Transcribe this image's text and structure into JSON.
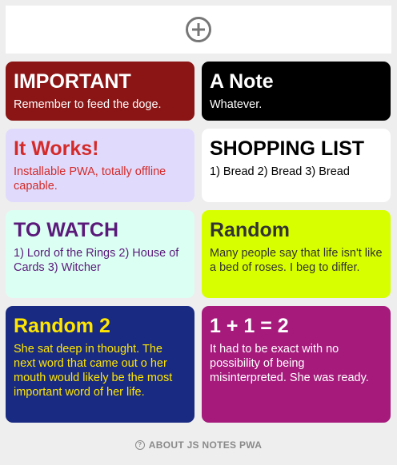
{
  "add_button": {
    "icon": "plus-circle-icon",
    "color": "#777777"
  },
  "notes": [
    {
      "title": "IMPORTANT",
      "body": "Remember to feed the doge.",
      "bg": "#8b1414",
      "fg": "#ffffff"
    },
    {
      "title": "A Note",
      "body": "Whatever.",
      "bg": "#000000",
      "fg": "#ffffff"
    },
    {
      "title": "It Works!",
      "body": "Installable PWA, totally offline capable.",
      "bg": "#e0dbfc",
      "fg": "#d42a2a"
    },
    {
      "title": "SHOPPING LIST",
      "body": "1) Bread 2) Bread 3) Bread",
      "bg": "#ffffff",
      "fg": "#000000"
    },
    {
      "title": "TO WATCH",
      "body": "1) Lord of the Rings 2) House of Cards 3) Witcher",
      "bg": "#dcfff3",
      "fg": "#5a1a7a"
    },
    {
      "title": "Random",
      "body": "Many people say that life isn't like a bed of roses. I beg to differ.",
      "bg": "#d8ff00",
      "fg": "#333333"
    },
    {
      "title": "Random 2",
      "body": "She sat deep in thought. The next word that came out o her mouth would likely be the most important word of her life.",
      "bg": "#182a82",
      "fg": "#ffe600"
    },
    {
      "title": "1 + 1 = 2",
      "body": "It had to be exact with no possibility of being misinterpreted. She was ready.",
      "bg": "#a61a7c",
      "fg": "#ffffff"
    }
  ],
  "footer": {
    "about_label": "ABOUT JS NOTES PWA",
    "icon": "question-circle-icon",
    "icon_glyph": "?"
  }
}
